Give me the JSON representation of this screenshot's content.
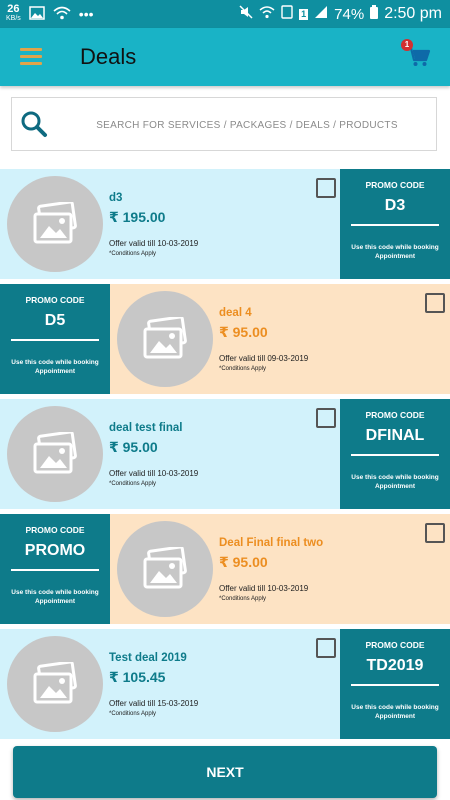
{
  "status_bar": {
    "speed_value": "26",
    "speed_unit": "KB/s",
    "sim_badge": "1",
    "battery": "74%",
    "time": "2:50 pm"
  },
  "header": {
    "title": "Deals",
    "cart_count": "1"
  },
  "search": {
    "placeholder": "SEARCH FOR SERVICES / PACKAGES / DEALS / PRODUCTS"
  },
  "promo_label": "PROMO CODE",
  "promo_note": "Use this code while booking Appointment",
  "conditions": "*Conditions Apply",
  "deals": [
    {
      "name": "d3",
      "price": "₹ 195.00",
      "valid": "Offer valid till 10-03-2019",
      "code": "D3"
    },
    {
      "name": "deal 4",
      "price": "₹ 95.00",
      "valid": "Offer valid till 09-03-2019",
      "code": "D5"
    },
    {
      "name": "deal test final",
      "price": "₹ 95.00",
      "valid": "Offer valid till 10-03-2019",
      "code": "DFINAL"
    },
    {
      "name": "Deal Final final two",
      "price": "₹ 95.00",
      "valid": "Offer valid till 10-03-2019",
      "code": "PROMO"
    },
    {
      "name": "Test deal 2019",
      "price": "₹ 105.45",
      "valid": "Offer valid till 15-03-2019",
      "code": "TD2019"
    }
  ],
  "next_label": "NEXT",
  "colors": {
    "primary": "#19b3c6",
    "promo_bg": "#0e7b8a",
    "blue_card": "#d2f2fb",
    "peach_card": "#fde3c4",
    "orange_text": "#ec8e21",
    "hamburger": "#e0a44a"
  }
}
